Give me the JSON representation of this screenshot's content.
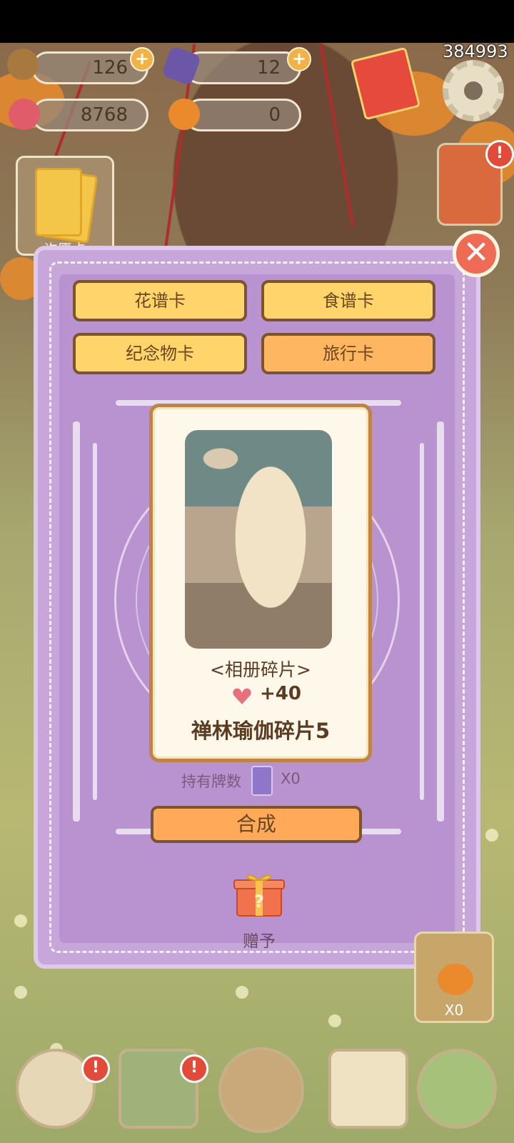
{
  "resources": {
    "acorn": {
      "value": "126",
      "icon": "acorn-icon"
    },
    "crystal": {
      "value": "12",
      "icon": "crystal-icon"
    },
    "heart": {
      "value": "8768",
      "icon": "heart-gem-icon"
    },
    "pumpkin": {
      "value": "0",
      "icon": "pumpkin-icon"
    },
    "plus_glyph": "+"
  },
  "score": "384993",
  "wish_card": {
    "label": "许愿卡"
  },
  "modal": {
    "close_glyph": "✕",
    "tabs": [
      {
        "label": "花谱卡"
      },
      {
        "label": "食谱卡"
      },
      {
        "label": "纪念物卡"
      },
      {
        "label": "旅行卡"
      }
    ],
    "active_tab": 3,
    "card": {
      "title": "<相册碎片>",
      "bonus": "+40",
      "name": "禅林瑜伽碎片5"
    },
    "owned": {
      "label": "持有牌数",
      "count": "X0"
    },
    "combine_label": "合成",
    "gift_label": "赠予"
  },
  "pumpkin_panel": {
    "count": "X0"
  },
  "alert_glyph": "!",
  "colors": {
    "modal_bg": "#c7a6d9",
    "tab": "#ffd56b",
    "tab_active": "#ffb660",
    "combine": "#ffa959",
    "text_brown": "#5b3b22"
  }
}
